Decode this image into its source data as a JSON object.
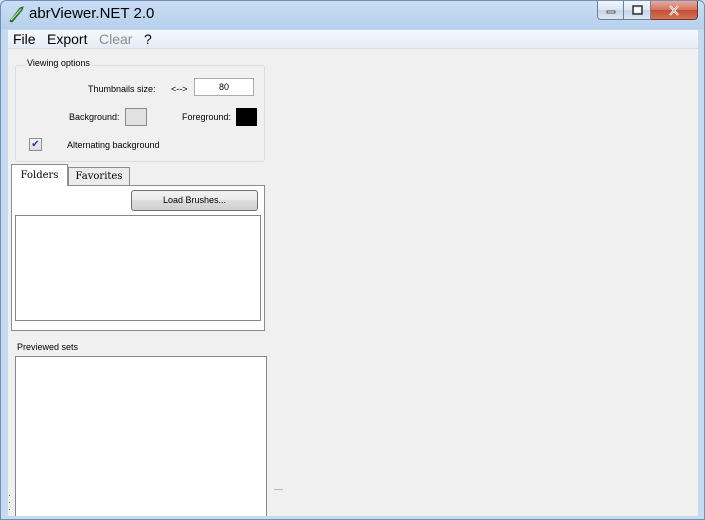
{
  "window": {
    "title": "abrViewer.NET 2.0",
    "icon": "feather-brush-icon",
    "caption_buttons": {
      "minimize": "minimize-icon",
      "maximize": "maximize-icon",
      "close": "close-icon"
    }
  },
  "menu": {
    "file": "File",
    "export": "Export",
    "clear": "Clear",
    "help": "?"
  },
  "viewing_options": {
    "legend": "Viewing options",
    "thumbnails_label": "Thumbnails size:",
    "arrows": "<-->",
    "thumbnails_value": "80",
    "background_label": "Background:",
    "background_color": "#e1e1e1",
    "foreground_label": "Foreground:",
    "foreground_color": "#000000",
    "alternating_label": "Alternating background",
    "alternating_checked": true
  },
  "tabs": {
    "folders": "Folders",
    "favorites": "Favorites",
    "active": "Folders"
  },
  "folders_panel": {
    "load_button": "Load Brushes..."
  },
  "previewed": {
    "label": "Previewed sets"
  }
}
